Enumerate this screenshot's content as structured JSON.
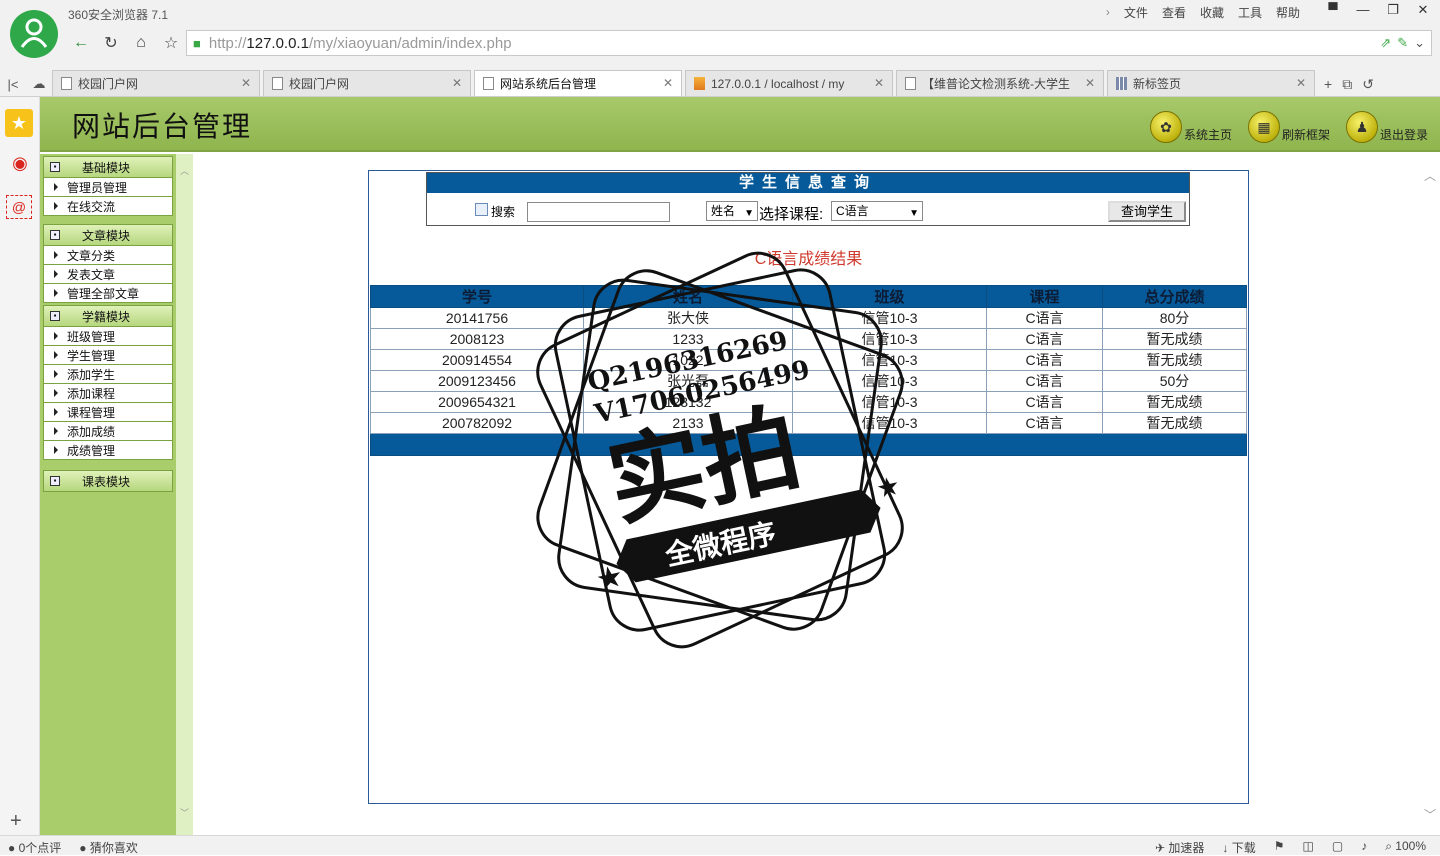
{
  "browser": {
    "app_title": "360安全浏览器 7.1",
    "menu": [
      "文件",
      "查看",
      "收藏",
      "工具",
      "帮助"
    ],
    "url_prefix": "http://",
    "url_host": "127.0.0.1",
    "url_path": "/my/xiaoyuan/admin/index.php",
    "tabs": [
      {
        "label": "校园门户网",
        "active": false
      },
      {
        "label": "校园门户网",
        "active": false
      },
      {
        "label": "网站系统后台管理",
        "active": true
      },
      {
        "label": "127.0.0.1 / localhost / my",
        "active": false
      },
      {
        "label": "【维普论文检测系统-大学生",
        "active": false
      },
      {
        "label": "新标签页",
        "active": false
      }
    ]
  },
  "header": {
    "title": "网站后台管理",
    "nav": [
      {
        "label": "系统主页",
        "icon": "paw-icon"
      },
      {
        "label": "刷新框架",
        "icon": "refresh-grid-icon"
      },
      {
        "label": "退出登录",
        "icon": "people-exit-icon"
      }
    ]
  },
  "sidebar": {
    "groups": [
      {
        "label": "基础模块",
        "items": [
          "管理员管理",
          "在线交流"
        ]
      },
      {
        "label": "文章模块",
        "items": [
          "文章分类",
          "发表文章",
          "管理全部文章"
        ]
      },
      {
        "label": "学籍模块",
        "items": [
          "班级管理",
          "学生管理",
          "添加学生",
          "添加课程",
          "课程管理",
          "添加成绩",
          "成绩管理"
        ]
      },
      {
        "label": "课表模块",
        "items": []
      }
    ]
  },
  "search": {
    "panel_title": "学生信息查询",
    "search_label": "搜索",
    "field_select": "姓名",
    "course_label": "选择课程:",
    "course_select": "C语言",
    "button_label": "查询学生"
  },
  "results": {
    "title": "C语言成绩结果",
    "columns": [
      "学号",
      "姓名",
      "班级",
      "课程",
      "总分成绩"
    ],
    "rows": [
      [
        "20141756",
        "张大侠",
        "信管10-3",
        "C语言",
        "80分"
      ],
      [
        "2008123",
        "1233",
        "信管10-3",
        "C语言",
        "暂无成绩"
      ],
      [
        "200914554",
        "1022",
        "信管10-3",
        "C语言",
        "暂无成绩"
      ],
      [
        "2009123456",
        "张光磊",
        "信管10-3",
        "C语言",
        "50分"
      ],
      [
        "2009654321",
        "123132",
        "信管10-3",
        "C语言",
        "暂无成绩"
      ],
      [
        "200782092",
        "2133",
        "信管10-3",
        "C语言",
        "暂无成绩"
      ]
    ]
  },
  "watermark": {
    "line1": "Q2196316269",
    "line2": "V17060256499",
    "main": "实拍",
    "ribbon": "全微程序"
  },
  "status": {
    "left": [
      "0个点评",
      "猜你喜欢"
    ],
    "right": [
      "加速器",
      "下载",
      "100%"
    ]
  }
}
